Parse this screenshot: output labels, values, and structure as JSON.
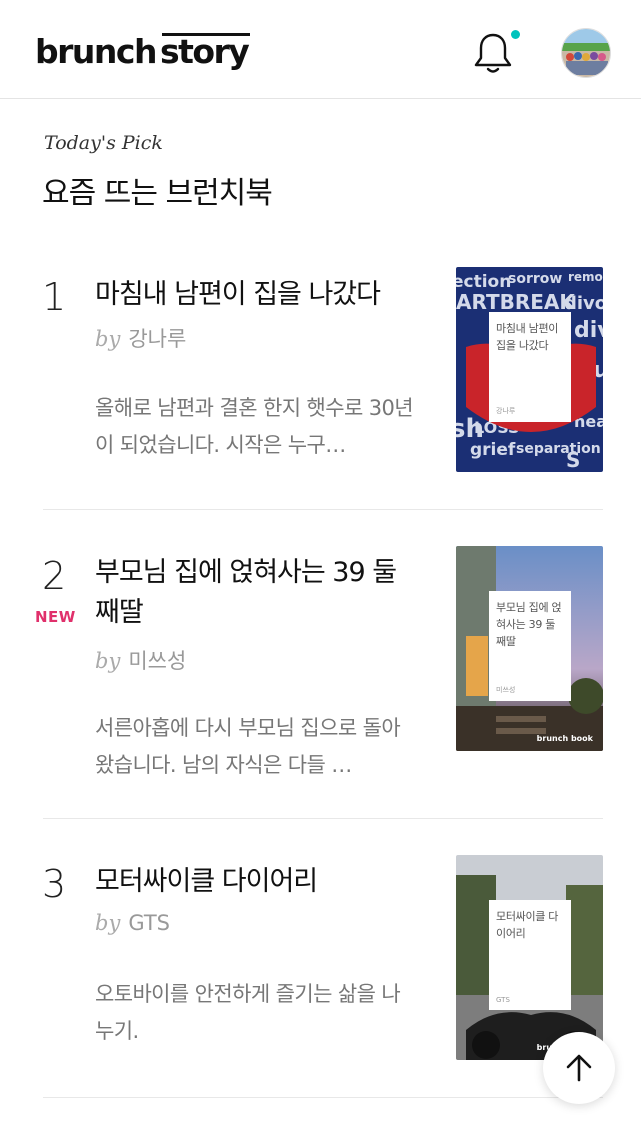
{
  "header": {
    "logo_part1": "brunch",
    "logo_part2": "story",
    "notification_icon": "bell-icon",
    "has_new_notification": true,
    "accent_color": "#00c3bd"
  },
  "section": {
    "subtitle": "Today's Pick",
    "title": "요즘 뜨는 브런치북"
  },
  "books": [
    {
      "rank": "1",
      "is_new": false,
      "title": "마침내 남편이 집을 나갔다",
      "by": "by",
      "author": "강나루",
      "description": "올해로 남편과 결혼 한지 햇수로 30년이 되었습니다. 시작은 누구…",
      "cover_title": "마침내 남편이 집을 나갔다",
      "cover_author": "강나루"
    },
    {
      "rank": "2",
      "is_new": true,
      "new_label": "NEW",
      "title": "부모님 집에 얹혀사는 39 둘째딸",
      "by": "by",
      "author": "미쓰성",
      "description": "서른아홉에 다시 부모님 집으로 돌아왔습니다. 남의 자식은 다들 …",
      "cover_title": "부모님 집에 얹혀사는 39 둘째딸",
      "cover_author": "미쓰성",
      "cover_brand": "brunch book"
    },
    {
      "rank": "3",
      "is_new": false,
      "title": "모터싸이클 다이어리",
      "by": "by",
      "author": "GTS",
      "description": "오토바이를 안전하게 즐기는 삶을 나누기.",
      "cover_title": "모터싸이클 다이어리",
      "cover_author": "GTS",
      "cover_brand": "brunch book"
    }
  ],
  "scroll_top_icon": "arrow-up-icon",
  "new_badge_color": "#e0306b"
}
